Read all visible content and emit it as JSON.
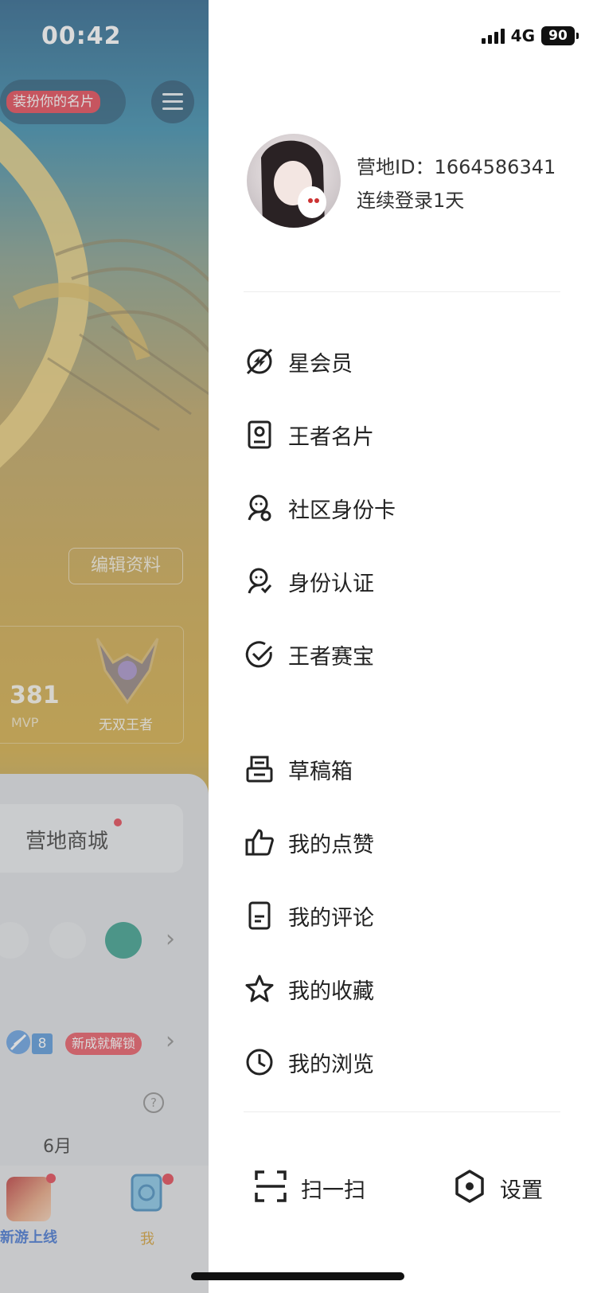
{
  "status_bar": {
    "time": "00:42",
    "network": "4G",
    "battery": "90"
  },
  "background_page": {
    "card_tag": "装扮你的名片",
    "edit_profile": "编辑资料",
    "mvp_count": "381",
    "mvp_label": "MVP",
    "rank_label": "无双王者",
    "shop_label": "营地商城",
    "achievement_count": "8",
    "achievement_tag": "新成就解锁",
    "month_label": "6月",
    "tab_game_label": "新游上线",
    "tab_me_label": "我"
  },
  "drawer": {
    "profile": {
      "camp_id": "营地ID：1664586341",
      "login_streak": "连续登录1天"
    },
    "primary_items": [
      {
        "label": "星会员",
        "icon": "star-member-icon"
      },
      {
        "label": "王者名片",
        "icon": "name-card-icon"
      },
      {
        "label": "社区身份卡",
        "icon": "community-id-icon"
      },
      {
        "label": "身份认证",
        "icon": "identity-verify-icon"
      },
      {
        "label": "王者赛宝",
        "icon": "sai-bao-check-icon"
      }
    ],
    "secondary_items": [
      {
        "label": "草稿箱",
        "icon": "drafts-icon"
      },
      {
        "label": "我的点赞",
        "icon": "thumbs-up-icon"
      },
      {
        "label": "我的评论",
        "icon": "comment-doc-icon"
      },
      {
        "label": "我的收藏",
        "icon": "star-icon"
      },
      {
        "label": "我的浏览",
        "icon": "clock-icon"
      }
    ],
    "bottom": {
      "scan_label": "扫一扫",
      "settings_label": "设置"
    }
  }
}
